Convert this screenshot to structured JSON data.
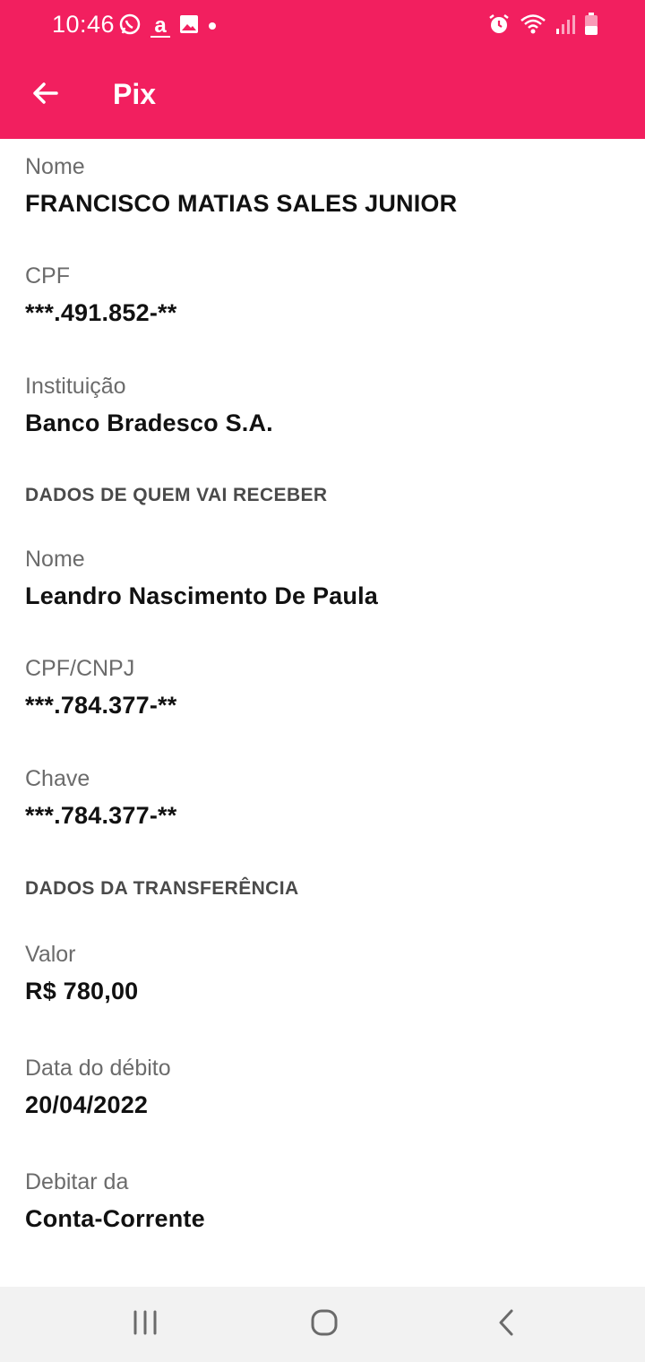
{
  "status_bar": {
    "time": "10:46",
    "amazon_glyph": "a",
    "icons_left": [
      "whatsapp-icon",
      "amazon-icon",
      "image-icon",
      "dot-icon"
    ],
    "icons_right": [
      "alarm-icon",
      "wifi-icon",
      "signal-icon",
      "battery-icon"
    ]
  },
  "toolbar": {
    "title": "Pix",
    "back_icon": "arrow-left-icon",
    "background": "#f21f5f"
  },
  "payer": {
    "nome_label": "Nome",
    "nome_value": "FRANCISCO MATIAS SALES JUNIOR",
    "cpf_label": "CPF",
    "cpf_value": "***.491.852-**",
    "instituicao_label": "Instituição",
    "instituicao_value": "Banco Bradesco S.A."
  },
  "receiver": {
    "section_title": "DADOS DE QUEM VAI RECEBER",
    "nome_label": "Nome",
    "nome_value": "Leandro Nascimento De Paula",
    "cpf_cnpj_label": "CPF/CNPJ",
    "cpf_cnpj_value": "***.784.377-**",
    "chave_label": "Chave",
    "chave_value": "***.784.377-**"
  },
  "transfer": {
    "section_title": "DADOS DA TRANSFERÊNCIA",
    "valor_label": "Valor",
    "valor_value": "R$ 780,00",
    "data_label": "Data do débito",
    "data_value": "20/04/2022",
    "debitar_label": "Debitar da",
    "debitar_value": "Conta-Corrente"
  },
  "nav_bar": {
    "icons": [
      "recent-apps-icon",
      "home-icon",
      "back-nav-icon"
    ]
  }
}
